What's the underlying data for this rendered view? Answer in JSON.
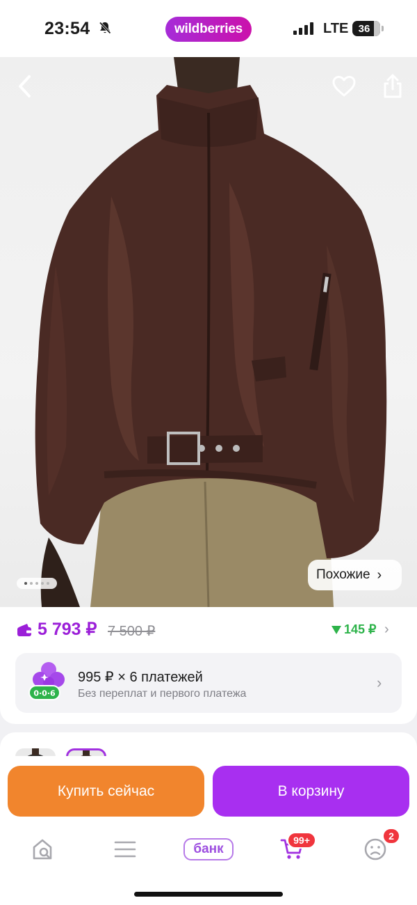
{
  "status_bar": {
    "time": "23:54",
    "brand": "wildberries",
    "network": "LTE",
    "battery": "36"
  },
  "hero": {
    "image_count": 5,
    "active_image_index": 0,
    "similar_label": "Похожие",
    "colors": {
      "jacket": "#4a2a24",
      "trousers": "#9a8a66",
      "background": "#efefef"
    }
  },
  "price": {
    "current": "5 793 ₽",
    "old": "7 500 ₽",
    "cashback": "145 ₽",
    "accent_color": "#9b1fd8",
    "cashback_color": "#2db34a"
  },
  "installment": {
    "title": "995 ₽ × 6 платежей",
    "subtitle": "Без переплат и первого платежа",
    "icon_badge": "0·0·6"
  },
  "actions": {
    "buy_now": "Купить сейчас",
    "add_to_cart": "В корзину",
    "buy_color": "#f1852d",
    "cart_color": "#a82ff0"
  },
  "tabbar": {
    "home_icon": "home-search-icon",
    "catalog_icon": "menu-icon",
    "bank_label": "банк",
    "cart_badge": "99+",
    "profile_badge": "2"
  }
}
